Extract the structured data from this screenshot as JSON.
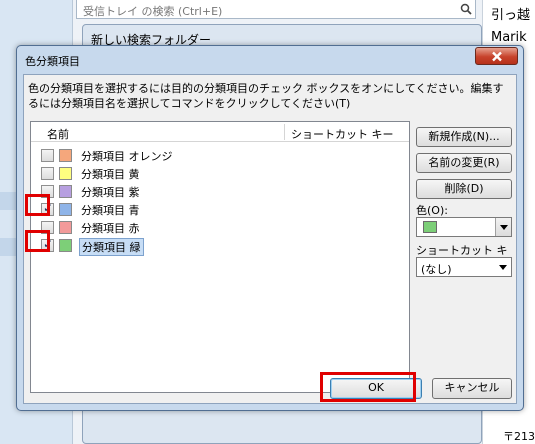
{
  "background": {
    "search_placeholder": "受信トレイ の検索 (Ctrl+E)",
    "behind_dialog_title": "新しい検索フォルダー",
    "right_text_1": "引っ越",
    "right_text_2": "Marik",
    "bottom_text": "〒213",
    "left_fragment": "亚"
  },
  "dialog": {
    "title": "色分類項目",
    "instructions": "色の分類項目を選択するには目的の分類項目のチェック ボックスをオンにしてください。編集するには分類項目名を選択してコマンドをクリックしてください(T)",
    "columns": {
      "name": "名前",
      "shortcut": "ショートカット キー"
    },
    "categories": [
      {
        "label": "分類項目 オレンジ",
        "color": "#f5a77c",
        "checked": false,
        "selected": false
      },
      {
        "label": "分類項目 黄",
        "color": "#ffff80",
        "checked": false,
        "selected": false
      },
      {
        "label": "分類項目 紫",
        "color": "#b79fe0",
        "checked": false,
        "selected": false
      },
      {
        "label": "分類項目 青",
        "color": "#8fb4e8",
        "checked": true,
        "selected": false
      },
      {
        "label": "分類項目 赤",
        "color": "#f29a9a",
        "checked": false,
        "selected": false
      },
      {
        "label": "分類項目 緑",
        "color": "#7dcf78",
        "checked": true,
        "selected": true
      }
    ],
    "buttons": {
      "new": "新規作成(N)...",
      "rename": "名前の変更(R)",
      "delete": "削除(D)",
      "ok": "OK",
      "cancel": "キャンセル"
    },
    "color_label": "色(O):",
    "selected_color": "#7dcf78",
    "shortcut_label": "ショートカット キー(S):",
    "shortcut_value": "(なし)",
    "highlight_color": "#e00000"
  }
}
